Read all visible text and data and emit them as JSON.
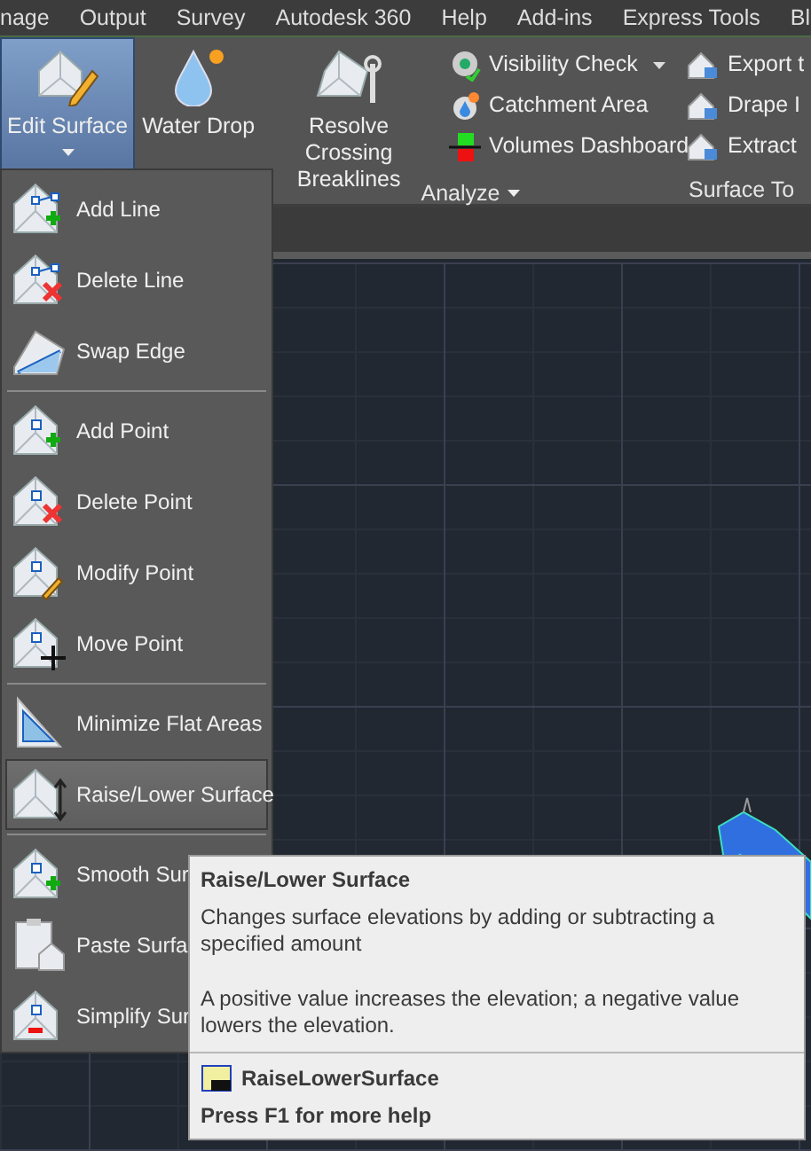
{
  "menu_bar": [
    {
      "label": "nage"
    },
    {
      "label": "Output"
    },
    {
      "label": "Survey"
    },
    {
      "label": "Autodesk 360"
    },
    {
      "label": "Help"
    },
    {
      "label": "Add-ins"
    },
    {
      "label": "Express Tools"
    },
    {
      "label": "Bl"
    }
  ],
  "ribbon": {
    "large_buttons": [
      {
        "label": "Edit Surface",
        "selected": true,
        "dropdown": true
      },
      {
        "label": "Water Drop",
        "selected": false,
        "dropdown": false
      },
      {
        "label": "Resolve Crossing Breaklines",
        "selected": false,
        "dropdown": false
      }
    ],
    "small_tools": [
      {
        "label": "Visibility Check",
        "dropdown": true
      },
      {
        "label": "Catchment Area",
        "dropdown": false
      },
      {
        "label": "Volumes Dashboard",
        "dropdown": false
      }
    ],
    "panel_label": "Analyze",
    "next_panel": {
      "tools": [
        {
          "label": "Export t"
        },
        {
          "label": "Drape I"
        },
        {
          "label": "Extract"
        }
      ],
      "panel_label": "Surface To"
    }
  },
  "dropdown_menu": {
    "groups": [
      [
        {
          "label": "Add Line",
          "selected": false
        },
        {
          "label": "Delete Line",
          "selected": false
        },
        {
          "label": "Swap Edge",
          "selected": false
        }
      ],
      [
        {
          "label": "Add Point",
          "selected": false
        },
        {
          "label": "Delete Point",
          "selected": false
        },
        {
          "label": "Modify Point",
          "selected": false
        },
        {
          "label": "Move Point",
          "selected": false
        }
      ],
      [
        {
          "label": "Minimize Flat Areas",
          "selected": false
        },
        {
          "label": "Raise/Lower Surface",
          "selected": true
        }
      ],
      [
        {
          "label": "Smooth Sur",
          "selected": false
        },
        {
          "label": "Paste Surfa",
          "selected": false
        },
        {
          "label": "Simplify Sur",
          "selected": false
        }
      ]
    ]
  },
  "tooltip": {
    "title": "Raise/Lower Surface",
    "description": "Changes surface elevations by adding or subtracting a specified amount",
    "note": "A positive value increases the elevation; a negative value lowers the elevation.",
    "command": "RaiseLowerSurface",
    "help": "Press F1 for more help"
  }
}
